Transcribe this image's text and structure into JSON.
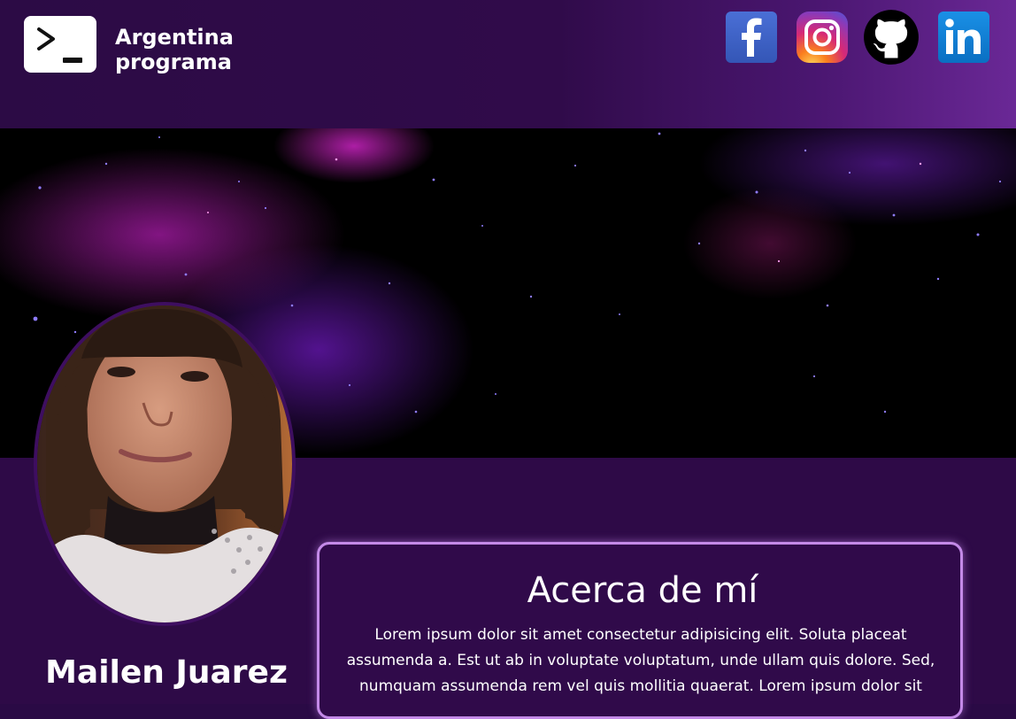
{
  "header": {
    "brand_line1": "Argentina",
    "brand_line2": "programa",
    "logo_icon": "terminal-prompt-icon",
    "social": [
      {
        "name": "facebook",
        "icon": "facebook-icon",
        "color": "#3b5998"
      },
      {
        "name": "instagram",
        "icon": "instagram-icon",
        "color": "#e1306c"
      },
      {
        "name": "github",
        "icon": "github-icon",
        "color": "#000000"
      },
      {
        "name": "linkedin",
        "icon": "linkedin-icon",
        "color": "#0a66c2"
      }
    ]
  },
  "profile": {
    "name": "Mailen Juarez"
  },
  "about": {
    "title": "Acerca de mí",
    "text": "Lorem ipsum dolor sit amet consectetur adipisicing elit. Soluta placeat assumenda a. Est ut ab in voluptate voluptatum, unde ullam quis dolore. Sed, numquam assumenda rem vel quis mollitia quaerat. Lorem ipsum dolor sit"
  },
  "colors": {
    "header_bg": "#2c0b45",
    "content_bg": "#2e0a47",
    "card_border": "#c48ae8",
    "text": "#ffffff"
  }
}
